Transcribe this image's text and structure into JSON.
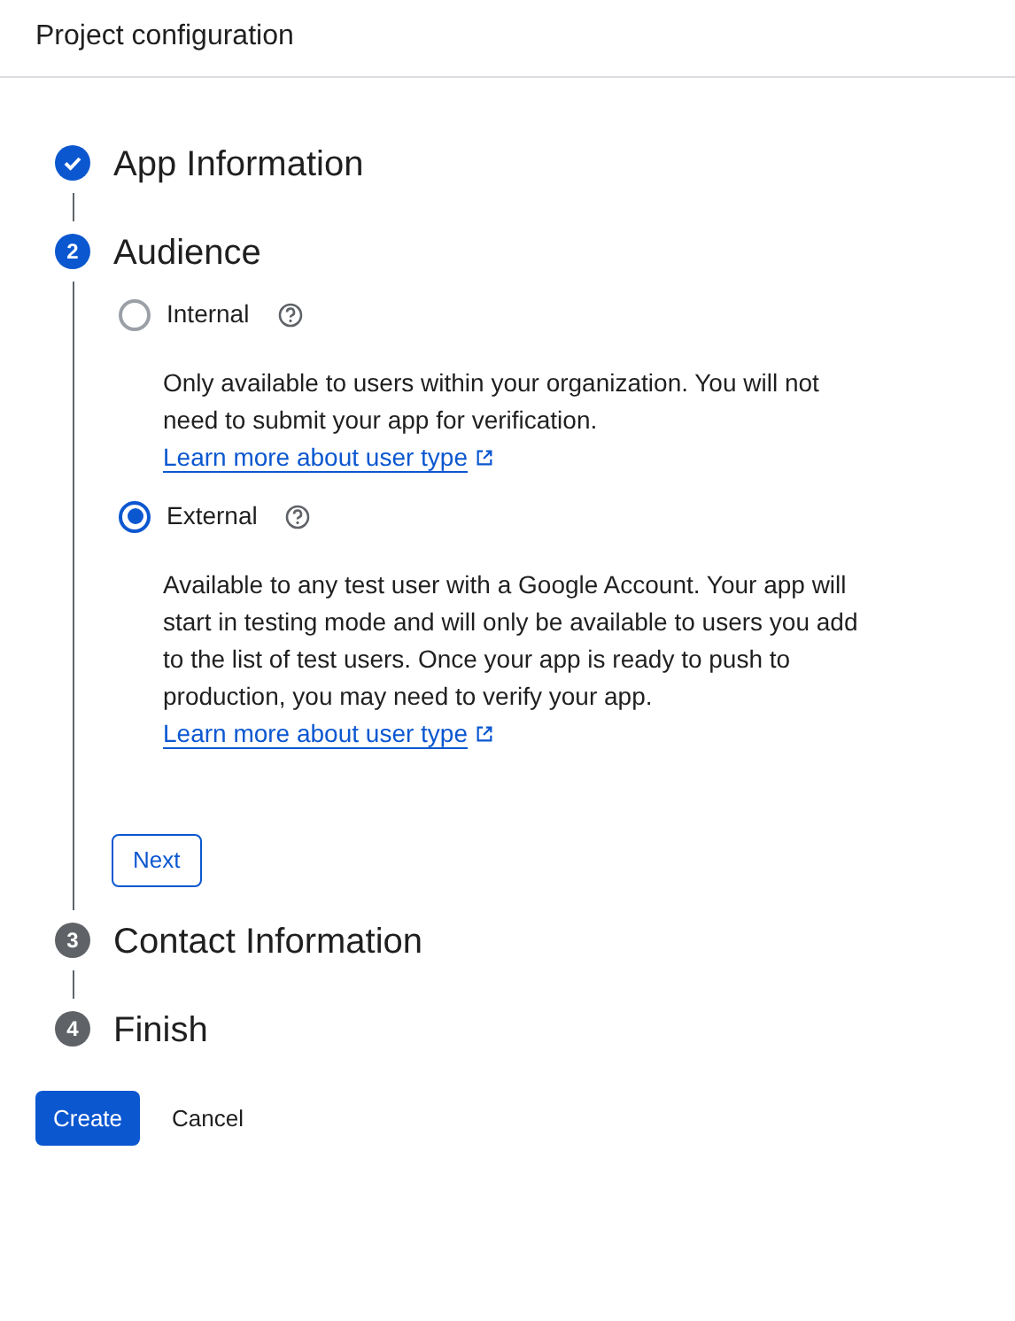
{
  "header": {
    "title": "Project configuration"
  },
  "steps": [
    {
      "title": "App Information",
      "completed": true,
      "active": false
    },
    {
      "number": "2",
      "title": "Audience",
      "completed": false,
      "active": true,
      "options": [
        {
          "label": "Internal",
          "selected": false,
          "description": "Only available to users within your organization. You will not need to submit your app for verification.",
          "link": "Learn more about user type"
        },
        {
          "label": "External",
          "selected": true,
          "description": "Available to any test user with a Google Account. Your app will start in testing mode and will only be available to users you add to the list of test users. Once your app is ready to push to production, you may need to verify your app.",
          "link": "Learn more about user type"
        }
      ],
      "next_button": "Next"
    },
    {
      "number": "3",
      "title": "Contact Information",
      "completed": false,
      "active": false
    },
    {
      "number": "4",
      "title": "Finish",
      "completed": false,
      "active": false
    }
  ],
  "footer": {
    "primary": "Create",
    "secondary": "Cancel"
  }
}
